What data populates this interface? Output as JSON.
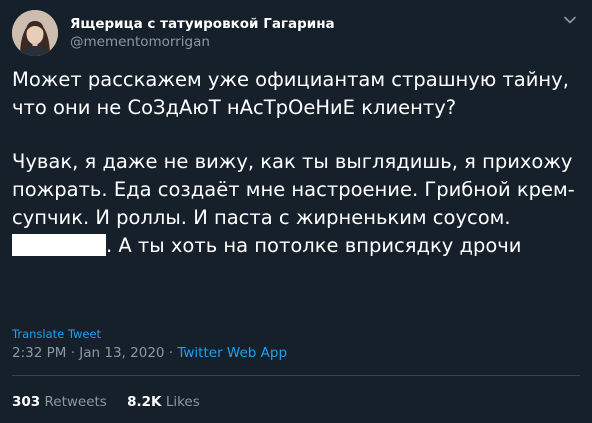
{
  "author": {
    "display_name": "Ящерица с татуировкой Гагарина",
    "handle": "@mementomorrigan",
    "avatar_icon": "profile-photo"
  },
  "tweet": {
    "paragraph_1": "Может расскажем уже официантам страшную тайну, что они не СоЗдАюТ нАсТрОеНиЕ клиенту?",
    "paragraph_2_before_redaction": "Чувак, я даже не вижу, как ты выглядишь, я прихожу пожрать. Еда создаёт мне настроение. Грибной крем-супчик. И роллы. И паста с жирненьким соусом. ",
    "paragraph_2_after_redaction": ". А ты хоть на потолке вприсядку дрочи"
  },
  "translate_label": "Translate Tweet",
  "meta": {
    "time": "2:32 PM",
    "separator_1": " · ",
    "date": "Jan 13, 2020",
    "separator_2": " · ",
    "source": "Twitter Web App"
  },
  "stats": {
    "retweets_count": "303",
    "retweets_label": "Retweets",
    "likes_count": "8.2K",
    "likes_label": "Likes"
  },
  "colors": {
    "background": "#15202b",
    "text": "#ffffff",
    "secondary": "#8899a6",
    "accent": "#1da1f2",
    "divider": "#38444d"
  }
}
